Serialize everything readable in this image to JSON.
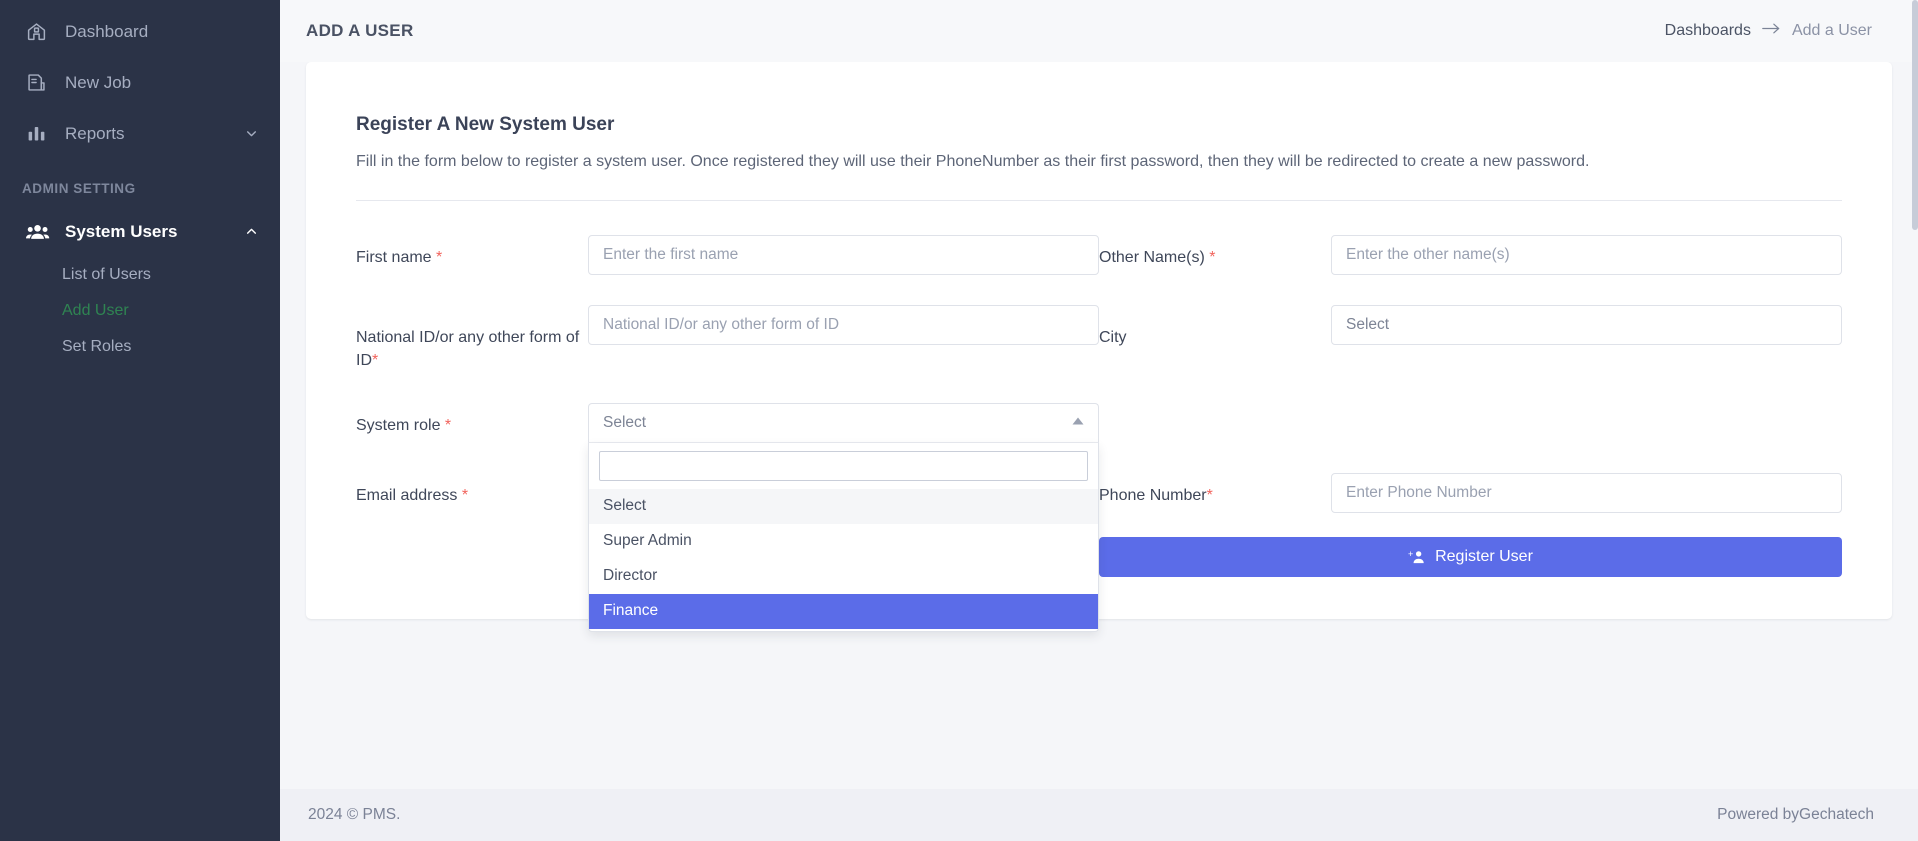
{
  "sidebar": {
    "items": [
      {
        "id": "dashboard",
        "label": "Dashboard",
        "icon": "home-icon"
      },
      {
        "id": "new-job",
        "label": "New Job",
        "icon": "file-icon"
      },
      {
        "id": "reports",
        "label": "Reports",
        "icon": "bar-chart-icon",
        "chevron": "chevron-down-icon"
      }
    ],
    "section_label": "ADMIN SETTING",
    "system_users": {
      "label": "System Users",
      "icon": "users-icon",
      "chevron": "chevron-up-icon",
      "sub_items": [
        {
          "id": "list-of-users",
          "label": "List of Users",
          "active": false
        },
        {
          "id": "add-user",
          "label": "Add User",
          "active": true
        },
        {
          "id": "set-roles",
          "label": "Set Roles",
          "active": false
        }
      ]
    },
    "colors": {
      "background": "#2b3347",
      "active_green": "#2f8452",
      "text": "#a6aec1"
    }
  },
  "topbar": {
    "title": "ADD A USER",
    "breadcrumb": {
      "parent": "Dashboards",
      "arrow": "arrow-right-icon",
      "current": "Add a User"
    }
  },
  "card": {
    "title": "Register A New System User",
    "description": "Fill in the form below to register a system user. Once registered they will use their PhoneNumber as their first password, then they will be redirected to create a new password."
  },
  "form": {
    "first_name": {
      "label": "First name",
      "required": true,
      "placeholder": "Enter the first name",
      "value": ""
    },
    "other_names": {
      "label": "Other Name(s)",
      "required": true,
      "placeholder": "Enter the other name(s)",
      "value": ""
    },
    "national_id": {
      "label": "National ID/or any other form of ID",
      "required": true,
      "placeholder": "National ID/or any other form of ID",
      "value": ""
    },
    "city": {
      "label": "City",
      "required": false,
      "selected": "Select"
    },
    "system_role": {
      "label": "System role",
      "required": true,
      "selected": "Select",
      "open": true,
      "caret": "caret-up-icon",
      "search_value": "",
      "options": [
        {
          "label": "Select",
          "state": "hovered"
        },
        {
          "label": "Super Admin",
          "state": "normal"
        },
        {
          "label": "Director",
          "state": "normal"
        },
        {
          "label": "Finance",
          "state": "selected"
        }
      ]
    },
    "email_address": {
      "label": "Email address",
      "required": true,
      "placeholder": "",
      "value": ""
    },
    "phone_number": {
      "label": "Phone Number",
      "required": true,
      "placeholder": "Enter Phone Number",
      "value": ""
    },
    "submit": {
      "label": "Register User",
      "icon": "user-plus-icon",
      "color": "#5b6ce8"
    }
  },
  "footer": {
    "left": "2024 © PMS.",
    "right": "Powered byGechatech"
  }
}
